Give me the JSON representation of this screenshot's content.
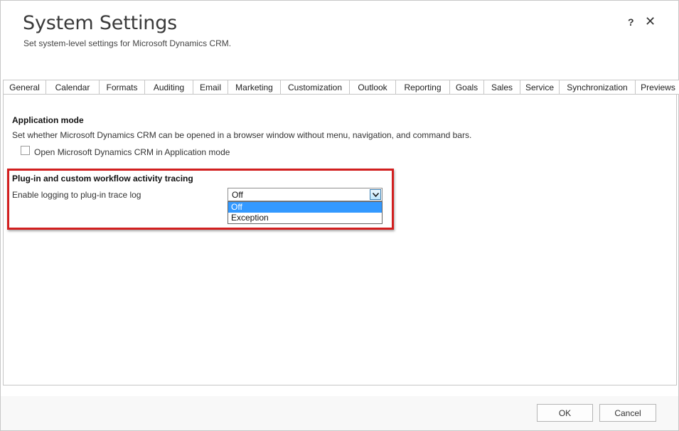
{
  "header": {
    "title": "System Settings",
    "subtitle": "Set system-level settings for Microsoft Dynamics CRM.",
    "help_label": "?",
    "close_label": "✕"
  },
  "tabs": [
    {
      "label": "General"
    },
    {
      "label": "Calendar"
    },
    {
      "label": "Formats"
    },
    {
      "label": "Auditing"
    },
    {
      "label": "Email"
    },
    {
      "label": "Marketing"
    },
    {
      "label": "Customization"
    },
    {
      "label": "Outlook"
    },
    {
      "label": "Reporting"
    },
    {
      "label": "Goals"
    },
    {
      "label": "Sales"
    },
    {
      "label": "Service"
    },
    {
      "label": "Synchronization"
    },
    {
      "label": "Previews"
    }
  ],
  "app_mode": {
    "heading": "Application mode",
    "description": "Set whether Microsoft Dynamics CRM can be opened in a browser window without menu, navigation, and command bars.",
    "checkbox_label": "Open Microsoft Dynamics CRM in Application mode",
    "checked": false
  },
  "tracing": {
    "heading": "Plug-in and custom workflow activity tracing",
    "label": "Enable logging to plug-in trace log",
    "selected_value": "Off",
    "options": [
      "Off",
      "Exception"
    ],
    "highlighted_option": "Off"
  },
  "footer": {
    "ok_label": "OK",
    "cancel_label": "Cancel"
  },
  "colors": {
    "highlight_border": "#d21f1f",
    "selected_option_bg": "#3399ff"
  }
}
